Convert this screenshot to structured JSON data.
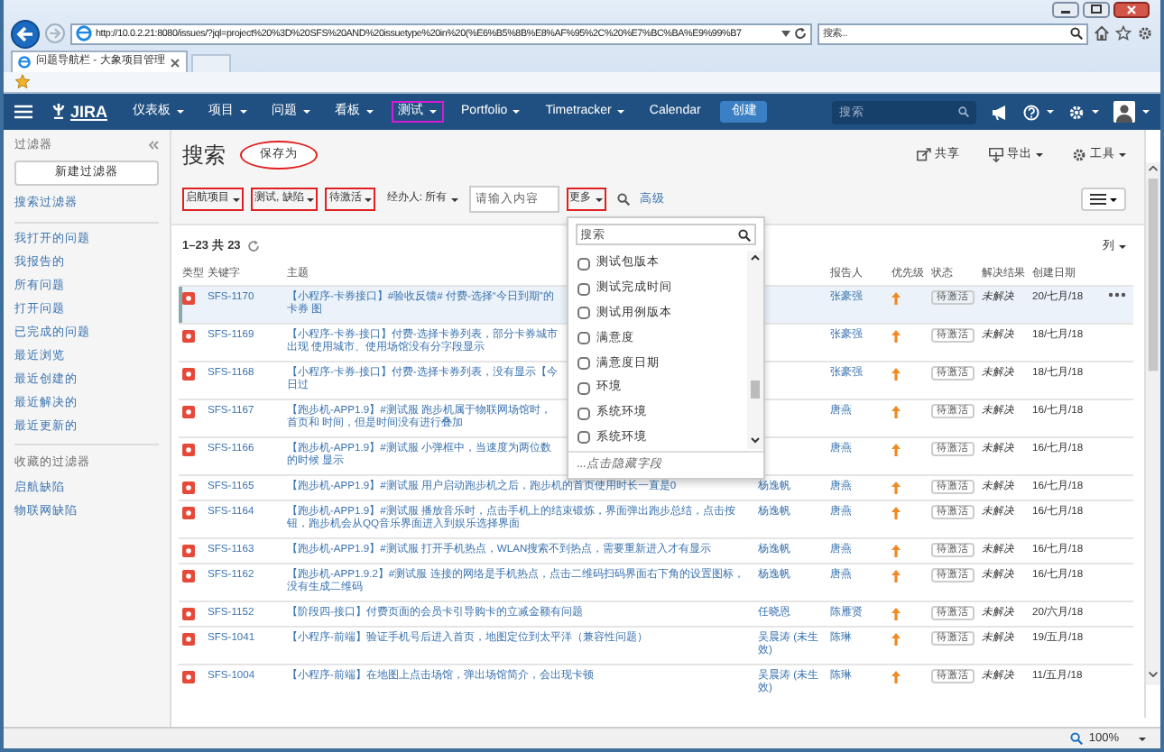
{
  "browser": {
    "url": "http://10.0.2.21:8080/issues/?jql=project%20%3D%20SFS%20AND%20issuetype%20in%20(%E6%B5%8B%E8%AF%95%2C%20%E7%BC%BA%E9%99%B7",
    "search_placeholder": "搜索...",
    "tab_title": "问题导航栏 - 大象项目管理",
    "zoom": "100%"
  },
  "navbar": {
    "logo": "JIRA",
    "items": [
      {
        "label": "仪表板",
        "dropdown": true,
        "marked": false
      },
      {
        "label": "项目",
        "dropdown": true,
        "marked": false
      },
      {
        "label": "问题",
        "dropdown": true,
        "marked": false
      },
      {
        "label": "看板",
        "dropdown": true,
        "marked": false
      },
      {
        "label": "测试",
        "dropdown": true,
        "marked": true
      },
      {
        "label": "Portfolio",
        "dropdown": true,
        "marked": false
      },
      {
        "label": "Timetracker",
        "dropdown": true,
        "marked": false
      },
      {
        "label": "Calendar",
        "dropdown": false,
        "marked": false
      }
    ],
    "create": "创建",
    "search_placeholder": "搜索"
  },
  "sidebar": {
    "title": "过滤器",
    "new_button": "新建过滤器",
    "search_link": "搜索过滤器",
    "items": [
      "我打开的问题",
      "我报告的",
      "所有问题",
      "打开问题",
      "已完成的问题",
      "最近浏览",
      "最近创建的",
      "最近解决的",
      "最近更新的"
    ],
    "favorites_title": "收藏的过滤器",
    "favorites": [
      "启航缺陷",
      "物联网缺陷"
    ]
  },
  "header": {
    "title": "搜索",
    "save_as": {
      "label": "保存为",
      "marked": true
    },
    "actions": [
      {
        "kind": "share",
        "label": "共享",
        "dropdown": false
      },
      {
        "kind": "export",
        "label": "导出",
        "dropdown": true
      },
      {
        "kind": "tools",
        "label": "工具",
        "dropdown": true
      }
    ]
  },
  "filters": [
    {
      "kind": "dropdown",
      "label": "启航项目",
      "marked": true
    },
    {
      "kind": "dropdown",
      "label": "测试, 缺陷",
      "marked": true
    },
    {
      "kind": "dropdown",
      "label": "待激活",
      "marked": true
    },
    {
      "kind": "dropdown",
      "label": "经办人: 所有",
      "marked": false
    },
    {
      "kind": "input",
      "placeholder": "请输入内容"
    },
    {
      "kind": "more",
      "label": "更多",
      "marked": true
    },
    {
      "kind": "search"
    },
    {
      "kind": "link",
      "label": "高级"
    }
  ],
  "more_menu": {
    "search_placeholder": "搜索",
    "options": [
      {
        "label": "测试包版本",
        "checked": false
      },
      {
        "label": "测试完成时间",
        "checked": false
      },
      {
        "label": "测试用例版本",
        "checked": false
      },
      {
        "label": "满意度",
        "checked": false
      },
      {
        "label": "满意度日期",
        "checked": false
      },
      {
        "label": "环境",
        "checked": false
      },
      {
        "label": "系统环境",
        "checked": false
      },
      {
        "label": "系统环境",
        "checked": false
      }
    ],
    "footer": "...点击隐藏字段"
  },
  "results": {
    "count": "1–23 共 23",
    "columns_button": "列"
  },
  "table": {
    "columns": {
      "type": "类型",
      "key": "关键字",
      "summary": "主题",
      "reporter": "报告人",
      "priority": "优先级",
      "status": "状态",
      "resolution": "解决结果",
      "created": "创建日期"
    },
    "rows": [
      {
        "key": "SFS-1170",
        "summary": "【小程序-卡券接口】#验收反馈# 付费-选择“今日到期”的卡券 图",
        "reporter": "张豪强",
        "status": "待激活",
        "resolution": "未解决",
        "created": "20/七月/18",
        "selected": true
      },
      {
        "key": "SFS-1169",
        "summary": "【小程序-卡券-接口】付费-选择卡券列表，部分卡券城市出现 使用城市、使用场馆没有分字段显示",
        "reporter": "张豪强",
        "status": "待激活",
        "resolution": "未解决",
        "created": "18/七月/18",
        "selected": false
      },
      {
        "key": "SFS-1168",
        "summary": "【小程序-卡券-接口】付费-选择卡券列表，没有显示【今日过",
        "reporter": "张豪强",
        "status": "待激活",
        "resolution": "未解决",
        "created": "18/七月/18",
        "selected": false
      },
      {
        "key": "SFS-1167",
        "summary": "【跑步机-APP1.9】#测试服 跑步机属于物联网场馆时，首页和 时间，但是时间没有进行叠加",
        "reporter": "唐燕",
        "status": "待激活",
        "resolution": "未解决",
        "created": "16/七月/18",
        "selected": false
      },
      {
        "key": "SFS-1166",
        "summary": "【跑步机-APP1.9】#测试服 小弹框中，当速度为两位数的时候 显示",
        "reporter": "唐燕",
        "status": "待激活",
        "resolution": "未解决",
        "created": "16/七月/18",
        "selected": false
      },
      {
        "key": "SFS-1165",
        "summary": "【跑步机-APP1.9】#测试服 用户启动跑步机之后，跑步机的首页使用时长一直是0",
        "assignee": "杨逸帆",
        "reporter": "唐燕",
        "status": "待激活",
        "resolution": "未解决",
        "created": "16/七月/18",
        "selected": false
      },
      {
        "key": "SFS-1164",
        "summary": "【跑步机-APP1.9】#测试服 播放音乐时，点击手机上的结束锻炼，界面弹出跑步总结，点击按钮，跑步机会从QQ音乐界面进入到娱乐选择界面",
        "assignee": "杨逸帆",
        "reporter": "唐燕",
        "status": "待激活",
        "resolution": "未解决",
        "created": "16/七月/18",
        "selected": false
      },
      {
        "key": "SFS-1163",
        "summary": "【跑步机-APP1.9】#测试服 打开手机热点，WLAN搜索不到热点，需要重新进入才有显示",
        "assignee": "杨逸帆",
        "reporter": "唐燕",
        "status": "待激活",
        "resolution": "未解决",
        "created": "16/七月/18",
        "selected": false
      },
      {
        "key": "SFS-1162",
        "summary": "【跑步机-APP1.9.2】#测试服 连接的网络是手机热点，点击二维码扫码界面右下角的设置图标，没有生成二维码",
        "assignee": "杨逸帆",
        "reporter": "唐燕",
        "status": "待激活",
        "resolution": "未解决",
        "created": "16/七月/18",
        "selected": false
      },
      {
        "key": "SFS-1152",
        "summary": "【阶段四-接口】付费页面的会员卡引导购卡的立减金额有问题",
        "assignee": "任晓恩",
        "reporter": "陈雁贤",
        "status": "待激活",
        "resolution": "未解决",
        "created": "20/六月/18",
        "selected": false
      },
      {
        "key": "SFS-1041",
        "summary": "【小程序-前端】验证手机号后进入首页，地图定位到太平洋（兼容性问题）",
        "assignee": "吴晨涛 (未生效)",
        "reporter": "陈琳",
        "status": "待激活",
        "resolution": "未解决",
        "created": "19/五月/18",
        "selected": false
      },
      {
        "key": "SFS-1004",
        "summary": "【小程序-前端】在地图上点击场馆，弹出场馆简介，会出现卡顿",
        "assignee": "吴晨涛 (未生效)",
        "reporter": "陈琳",
        "status": "待激活",
        "resolution": "未解决",
        "created": "11/五月/18",
        "selected": false
      }
    ]
  }
}
